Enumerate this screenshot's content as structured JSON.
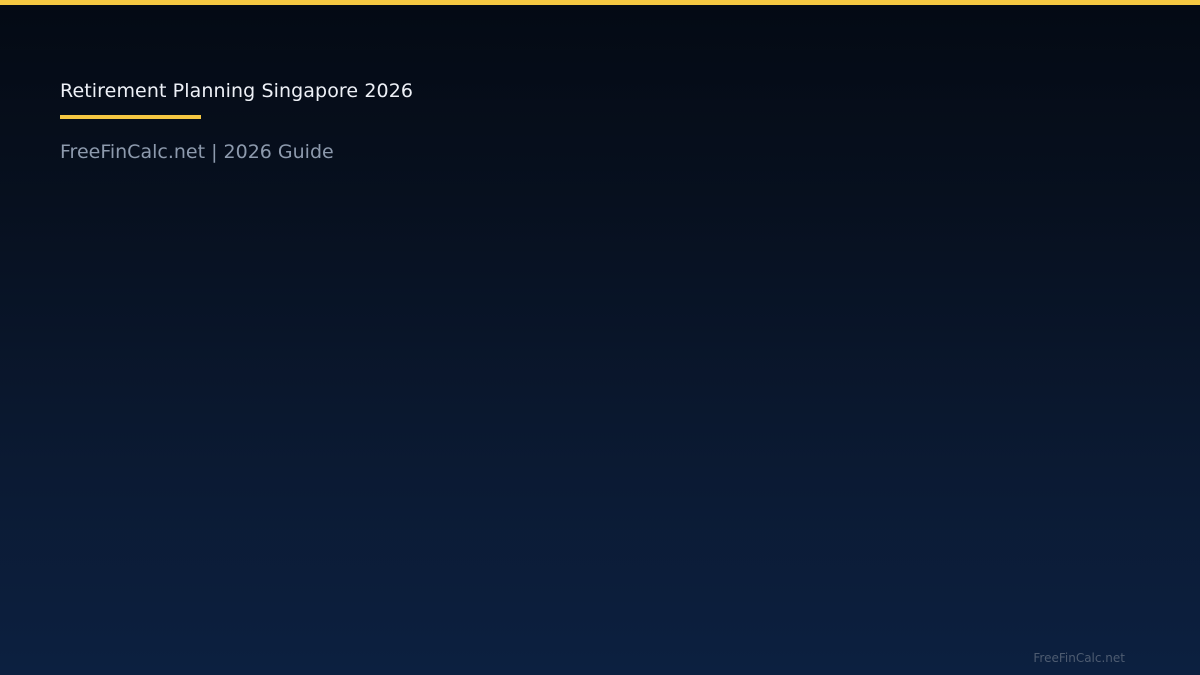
{
  "slide": {
    "title": "Retirement Planning Singapore 2026",
    "subtitle": "FreeFinCalc.net | 2026 Guide",
    "watermark": "FreeFinCalc.net"
  },
  "colors": {
    "accent": "#f5c842",
    "background_top": "#040a14",
    "background_bottom": "#0c2040",
    "title_text": "#eef1f7",
    "subtitle_text": "#8d9aad",
    "watermark_text": "#4e5c71"
  }
}
